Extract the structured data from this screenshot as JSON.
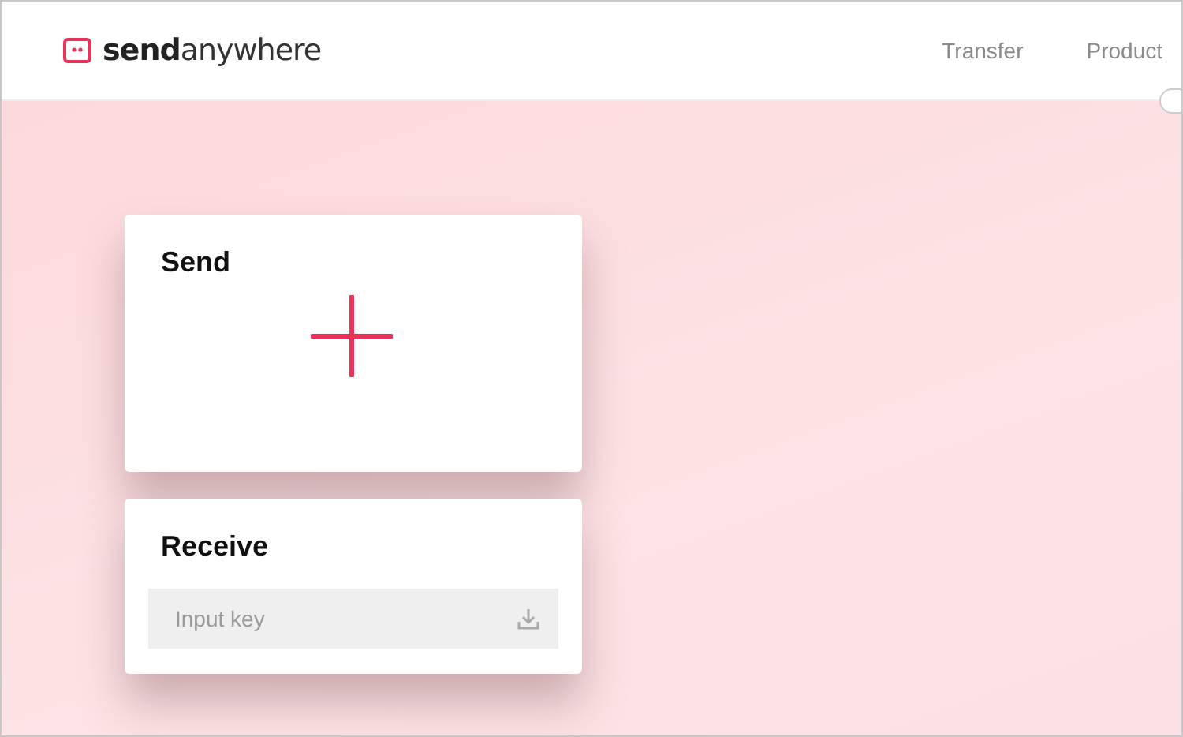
{
  "header": {
    "logo": "**send**anywhere",
    "nav": [
      {
        "label": "Transfer"
      },
      {
        "label": "Product"
      }
    ]
  },
  "send": {
    "title": "Send"
  },
  "receive": {
    "title": "Receive",
    "field": {
      "placeholder": "Input key"
    }
  }
}
